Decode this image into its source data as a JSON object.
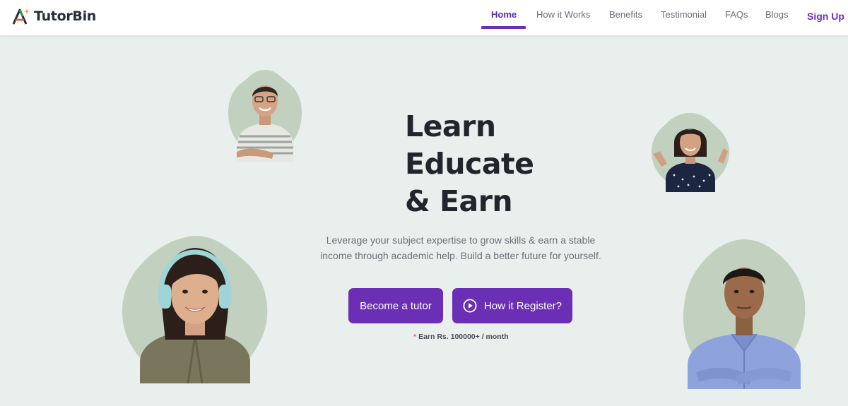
{
  "brand": {
    "name": "TutorBin",
    "accent": "#6a2fb5"
  },
  "nav": {
    "items": [
      {
        "label": "Home",
        "active": true
      },
      {
        "label": "How it Works",
        "active": false
      },
      {
        "label": "Benefits",
        "active": false
      },
      {
        "label": "Testimonial",
        "active": false
      },
      {
        "label": "FAQs",
        "active": false
      },
      {
        "label": "Blogs",
        "active": false
      }
    ],
    "signup_label": "Sign Up"
  },
  "hero": {
    "title_lines": [
      "Learn",
      "Educate",
      "& Earn"
    ],
    "description": "Leverage your subject expertise to grow skills & earn a stable income through academic help. Build a better future for yourself.",
    "primary_button": "Become a tutor",
    "secondary_button": "How it Register?",
    "secondary_button_icon": "play-circle-icon",
    "earn_note_marker": "*",
    "earn_note": "Earn Rs. 100000+ / month"
  },
  "colors": {
    "page_background": "#e9efec",
    "portrait_blob": "#c2d1bf",
    "title_text": "#22252b"
  }
}
